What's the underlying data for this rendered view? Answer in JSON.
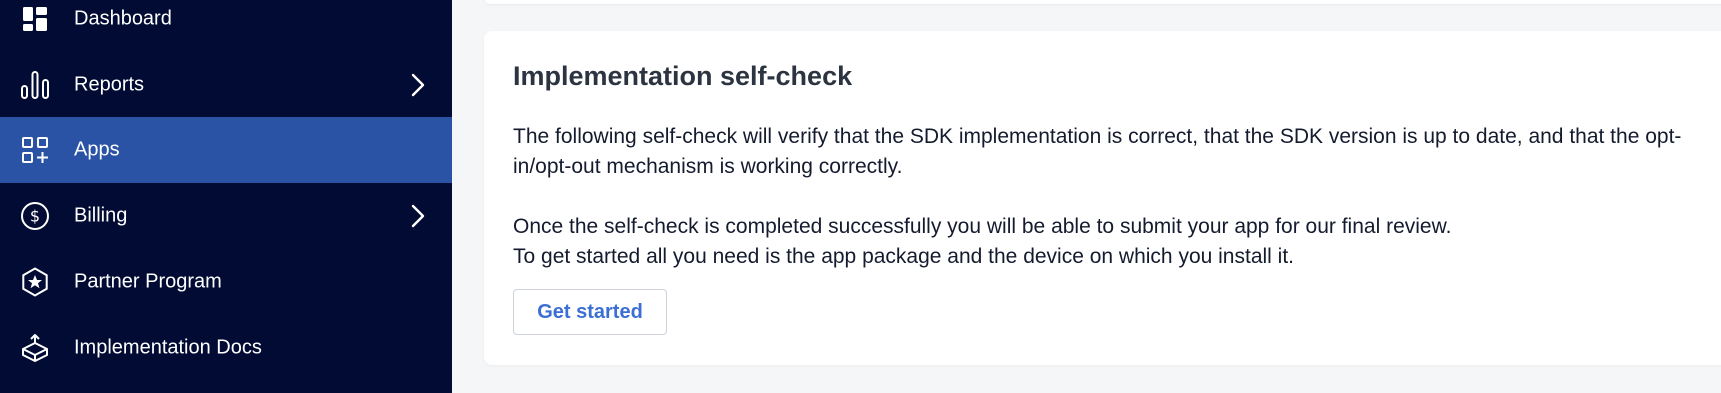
{
  "sidebar": {
    "items": [
      {
        "label": "Dashboard",
        "icon": "dashboard-icon",
        "active": false,
        "has_chevron": false
      },
      {
        "label": "Reports",
        "icon": "bar-chart-icon",
        "active": false,
        "has_chevron": true
      },
      {
        "label": "Apps",
        "icon": "apps-grid-icon",
        "active": true,
        "has_chevron": false
      },
      {
        "label": "Billing",
        "icon": "dollar-circle-icon",
        "active": false,
        "has_chevron": true
      },
      {
        "label": "Partner Program",
        "icon": "star-badge-icon",
        "active": false,
        "has_chevron": false
      },
      {
        "label": "Implementation Docs",
        "icon": "package-box-icon",
        "active": false,
        "has_chevron": false
      }
    ]
  },
  "main": {
    "card": {
      "title": "Implementation self-check",
      "paragraph1": "The following self-check will verify that the SDK implementation is correct, that the SDK version is up to date, and that the opt-in/opt-out mechanism is working correctly.",
      "paragraph2_line1": "Once the self-check is completed successfully you will be able to submit your app for our final review.",
      "paragraph2_line2": "To get started all you need is the app package and the device on which you install it.",
      "button_label": "Get started"
    }
  },
  "colors": {
    "sidebar_bg": "#020b33",
    "active_bg": "#2a53a6",
    "page_bg": "#f5f6f8",
    "button_text": "#3b6fd4"
  }
}
